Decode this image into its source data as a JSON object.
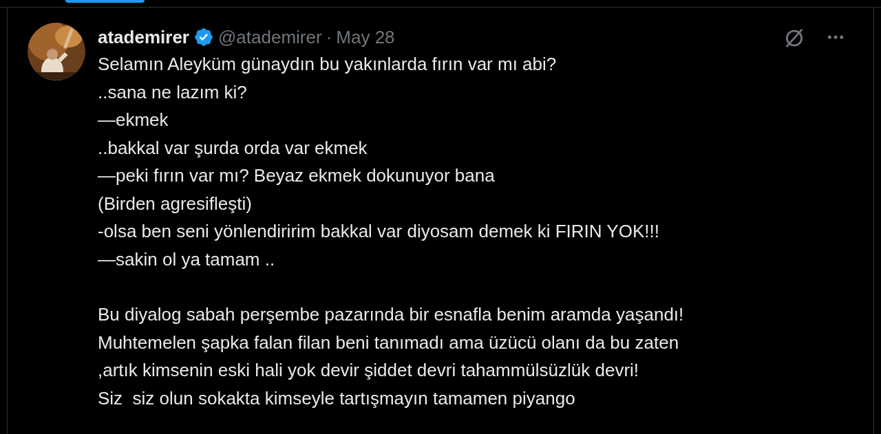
{
  "post": {
    "display_name": "atademirer",
    "verified": true,
    "handle": "@atademirer",
    "separator": "·",
    "date": "May 28",
    "paragraphs": [
      [
        "Selamın Aleyküm günaydın bu yakınlarda fırın var mı abi?",
        "..sana ne lazım ki?",
        "—ekmek",
        "..bakkal var şurda orda var ekmek",
        "—peki fırın var mı? Beyaz ekmek dokunuyor bana",
        "(Birden agresifleşti)",
        "-olsa ben seni yönlendiririm bakkal var diyosam demek ki FIRIN YOK!!!",
        "—sakin ol ya tamam .."
      ],
      [
        "Bu diyalog sabah perşembe pazarında bir esnafla benim aramda yaşandı!",
        "Muhtemelen şapka falan filan beni tanımadı ama üzücü olanı da bu zaten",
        ",artık kimsenin eski hali yok devir şiddet devri tahammülsüzlük devri!",
        "Siz  siz olun sokakta kimseyle tartışmayın tamamen piyango"
      ]
    ]
  }
}
